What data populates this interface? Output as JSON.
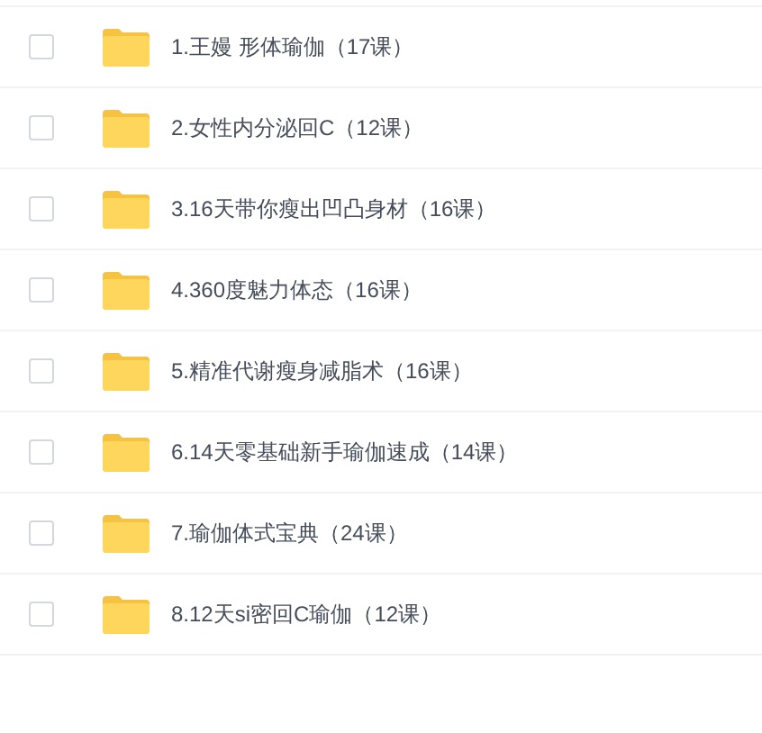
{
  "items": [
    {
      "name": "1.王嫚 形体瑜伽（17课）",
      "checked": false
    },
    {
      "name": "2.女性内分泌回C（12课）",
      "checked": false
    },
    {
      "name": "3.16天带你瘦出凹凸身材（16课）",
      "checked": false
    },
    {
      "name": "4.360度魅力体态（16课）",
      "checked": false
    },
    {
      "name": "5.精准代谢瘦身减脂术（16课）",
      "checked": false
    },
    {
      "name": "6.14天零基础新手瑜伽速成（14课）",
      "checked": false
    },
    {
      "name": "7.瑜伽体式宝典（24课）",
      "checked": false
    },
    {
      "name": "8.12天si密回C瑜伽（12课）",
      "checked": false
    }
  ]
}
